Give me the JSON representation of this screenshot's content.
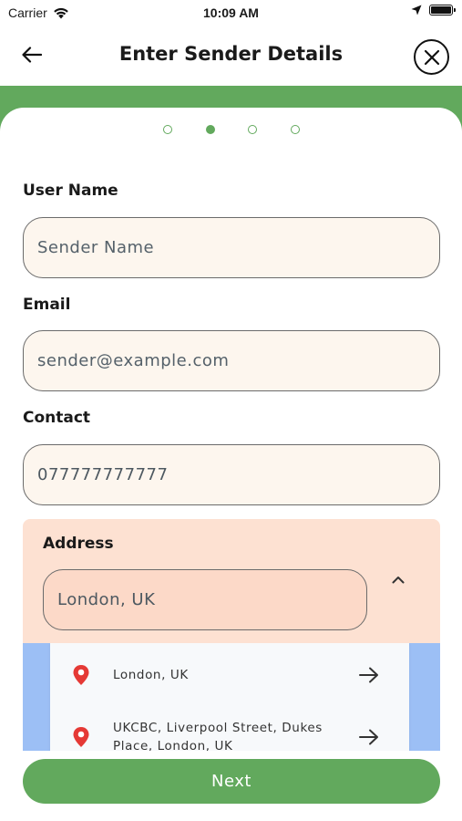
{
  "status_bar": {
    "carrier": "Carrier",
    "time": "10:09 AM"
  },
  "header": {
    "title": "Enter Sender Details",
    "back_icon": "arrow-left-icon",
    "close_icon": "close-icon"
  },
  "stepper": {
    "total_steps": 4,
    "current_step": 2
  },
  "form": {
    "user_name": {
      "label": "User Name",
      "placeholder": "Sender Name",
      "value": ""
    },
    "email": {
      "label": "Email",
      "placeholder": "sender@example.com",
      "value": ""
    },
    "contact": {
      "label": "Contact",
      "placeholder": "",
      "value": "077777777777"
    },
    "address": {
      "label": "Address",
      "value": "London, UK",
      "suggestions": [
        {
          "text": "London, UK"
        },
        {
          "text": "UKCBC, Liverpool Street, Dukes Place, London, UK"
        }
      ]
    }
  },
  "footer": {
    "next_label": "Next"
  },
  "colors": {
    "brand_green": "#62a95d",
    "field_bg": "#fdf6ee",
    "address_block_bg": "#fde1d2",
    "suggest_bg": "#9cbff5",
    "pin_red": "#e53935"
  }
}
